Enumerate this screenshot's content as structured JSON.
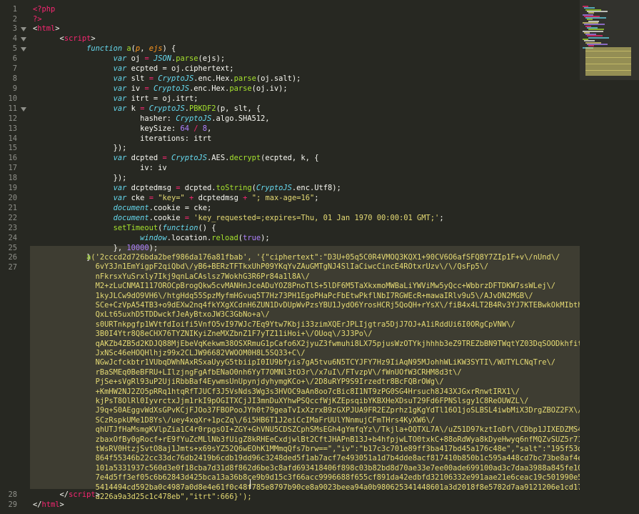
{
  "line_numbers": [
    "1",
    "2",
    "3",
    "4",
    "5",
    "6",
    "7",
    "8",
    "9",
    "10",
    "11",
    "12",
    "13",
    "14",
    "15",
    "16",
    "17",
    "18",
    "19",
    "20",
    "21",
    "22",
    "23",
    "24",
    "25",
    "26",
    "27",
    "28",
    "29"
  ],
  "code": {
    "l1": "<?php",
    "l2": "?>",
    "l3_tag": "html",
    "l4_tag": "script",
    "l5": {
      "kw": "function",
      "name": "a",
      "p1": "p",
      "p2": "ejs"
    },
    "l6": {
      "var": "var",
      "id": "oj",
      "obj": "JSON",
      "fn": "parse",
      "arg": "(ejs);"
    },
    "l7": {
      "var": "var",
      "rest": "ecpted = oj.ciphertext;"
    },
    "l8": {
      "var": "var",
      "id": "slt",
      "obj": "CryptoJS",
      "mid": ".enc.Hex.",
      "fn": "parse",
      "arg": "(oj.salt);"
    },
    "l9": {
      "var": "var",
      "id": "iv",
      "obj": "CryptoJS",
      "mid": ".enc.Hex.",
      "fn": "parse",
      "arg": "(oj.iv);"
    },
    "l10": {
      "var": "var",
      "rest": "itrt = oj.itrt;"
    },
    "l11": {
      "var": "var",
      "id": "k",
      "obj": "CryptoJS",
      "fn": "PBKDF2",
      "arg": "(p, slt, {"
    },
    "l12": {
      "key": "hasher: ",
      "obj": "CryptoJS",
      "rest": ".algo.SHA512,"
    },
    "l13": {
      "key": "keySize: ",
      "n1": "64",
      "n2": "8"
    },
    "l14": "iterations: itrt",
    "l15": "});",
    "l16": {
      "var": "var",
      "id": "dcpted",
      "obj": "CryptoJS",
      "mid": ".AES.",
      "fn": "decrypt",
      "arg": "(ecpted, k, {"
    },
    "l17": "iv: iv",
    "l18": "});",
    "l19": {
      "var": "var",
      "id": "dcptedmsg",
      "mid": "dcpted.",
      "fn": "toString",
      "obj": "CryptoJS",
      "rest": ".enc.Utf8);"
    },
    "l20": {
      "var": "var",
      "id": "cke",
      "s1": "\"key=\"",
      "mid": "dcptedmsg",
      "s2": "\"; max-age=16\""
    },
    "l21": {
      "obj": "document",
      "rest": ".cookie = cke;"
    },
    "l22": {
      "obj": "document",
      "s": "'key_requested=;expires=Thu, 01 Jan 1970 00:00:01 GMT;'"
    },
    "l23": {
      "fn": "setTimeout",
      "kw": "function"
    },
    "l24": {
      "obj": "window",
      "rest": ".location.",
      "fn": "reload",
      "b": "true"
    },
    "l25": {
      "n": "10000"
    },
    "l26": "}",
    "l27": [
      "a('2cccd2d726bda2bef986da176a81fbab', '{\"ciphertext\":\"D3U+05q5C0R4VMOQ3KQX1+90CV6O6afSFQ8Y7ZIp1F+v\\/nUnd\\/",
      "6vY3Jn1EmYigpF2qiQbd\\/yB6+BERzTFTkxUhP09YKqYvZAuGMTgNJ4SlIaCiwcCincE4ROtxrUzv\\/\\/QsFp5\\/",
      "nFkrsxYuSrxly7Ikj9qnLaCAslsz7WokhG3R6Pr84a1l8A\\/",
      "M2+zLuCNMAI117OROCpBrogQkw5cvMANHnJceADuYOZ8PnoTlS+5lDF6M5TaXkxmoMWBaLiYWViMw5yQcc+WbbrzDFTDKW7ssWLej\\/",
      "1kyJLCw9dO9VH6\\/htgHdq55SpzMyfmHGvuq5T7Hz73PH1EgoPHaPcFbEtwPkflNbI7RGWEcR+mawaIRlv9u5\\/AJvDN2MGB\\/",
      "SCe+CzVpA54TB3+o9dEXw2nq4fkYXgXCdnH6ZUN1DvDUpWvPzsYBU1JydO6YrosHCRj5QoQH+rYsX\\/fiB4x4LT2B4Rv3YJ7KTEBwkOkMIbth3MTbc\\/",
      "QxLt65uxhD5TDDwckfJeAyBtxoJW3C3GbNo+a\\/",
      "s0URTnkpgfp1WVtfdIoifi5VnfO5vI97WJc7Eq9Ytw7Kbji33zimXQErJPLIjgtra5DjJ7OJ+A1iRddUi6I0ORgCpVNW\\/",
      "3B0I4Ytr8Q8eCHX76TYZNIKyiZneMXZbnZ1F7yTZ11iHoi+\\/OUoq\\/3J3Po\\/",
      "qAKZb4ZB5d2KDJQ88MjEbeVqKekwm38OSXRmuG1pCafo6X2jyuZ3fwmuhi8LX75pjusWzOTYkjhhhb3eZ9TREZbBN9TWqtYZ03DqSOODkhfitt6Ky\\/",
      "JxNSc46eHOQHlhjz99x2CLJW96682VWOOM0H8L5SQ33+C\\/",
      "NGwJcfckbtr1VUbqDWhNAxRSxaUyyG5tbiipI0IU9bfyis7gA5tvu6N5TCYJFY7Hz9IiAqN95MJohhWLiKW3SYTI\\/WUTYLCNqTre\\/",
      "rBaSMEq0BeBFRU+LIlzjngFgAfbENaO0nh6YyT7OMNl3tO3r\\/x7uI\\/FTvzpV\\/fWnUOfW3CRHM8d3t\\/",
      "PjSe+sVgRl93uP2UjiRbbBaf4EywmsUnUpynjdyhymgKCo+\\/2D8uRYP9S9Irzedtr8BcFQBrOWg\\/",
      "+KmHW2NJ2ZO5pRRq1htqRfTJUCf3J5VsNds3Wg3s3HVOC9aAn8oo7cBic8I1NT9zPG0SG4Hrsuch8J43XJGxrRnwtIRX1\\/",
      "kjPsT8OlRl0IyvrctxJjm1rkI9pOGITXCjJI3mnDuXYhwPSQccfWjKZEpsqibYKBXHeXDsuT29Fd6FPNSlsgy1C8ReOUWZL\\/",
      "J9q+S0AEggvWdXsGPvKCjFJOo37FBOPooJYh0t79geaTvIxXzrxB9zGXPJUA9FR2EZprhz1gKgYdTl16O1joSLBSL4iwbMiX3DrgZBOZ2FX\\/",
      "SCzRspkUMe1D8Ys\\/uey4xqXr+1pcZq\\/6i5HB6T1J2eiCcIMaFrUUlYNnmujCFmTHrs4KyXW6\\/",
      "qhUTJfHaMsmgKVlpZia1C4r0rpgsOI+ZGY+GhVNU5CDSZCphSMsEGh4gYmfqYz\\/Tkjla+OQTXL7A\\/uZ51D97kztIoDf\\/CDbp1JIXEDZMS4NmmhzPi",
      "zbaxOfBy0gRocf+rE9fYuZcMLlNb3fUigZ8kRHEeCxdjwlBt2CftJHAPnB13J+b4hfpjwLTO0txkC+88oRdWya8kDyeHwyq6nfMQZvSUZ5r71+9zT+UpI4i",
      "tWsRV0HtzjSvtO8aj1Jmts+x69sYZ52Q6wEOhK1MMmqQfs7brw==\",\"iv\":\"b17c3c701e89ff3ba417bd45a176c48e\",\"salt\":\"195f53dfda50ded81",
      "864f55346b22cc33dc76db2419b6cdb19dd96c3248ded5f1ab7acf7e493051a1d7b4dde8acf817410b850b1c595a448cd7bc73be8af4e58f9b66be5",
      "101a5331937c560d3e0f18cba7d31d8f862d6be3c8afd693418406f898c03b82bd8d70ae33e7ee00ade699100ad3c7daa3988a845fe10b8478517d5",
      "7e4d5ff3ef05c6b62843d425bca13a36b8ce9b9d15c3f66acc9996688f655cf891da42edbfd32106332e991aae21e6ceac19c501990e5050f0b363c",
      "5414494cd592ba0c4987a0d8e4e61f0c48f785e8797b90ce8a9023beea94a0b980625341448601a3d2018f8e5782d7aa9121206e1cd173609ecc816",
      "a226a9a3d25c1c478eb\",\"itrt\":666}');"
    ],
    "l28_tag": "script",
    "l29_tag": "html"
  },
  "colors": {
    "background": "#272822",
    "gutter_text": "#8f908a",
    "keyword": "#f92672",
    "storage": "#66d9ef",
    "function": "#a6e22e",
    "parameter": "#fd971f",
    "number": "#ae81ff",
    "string": "#e6db74",
    "plain": "#f8f8f2",
    "current_line": "#3e3d32"
  },
  "icons": {
    "fold": "fold-triangle-icon"
  }
}
